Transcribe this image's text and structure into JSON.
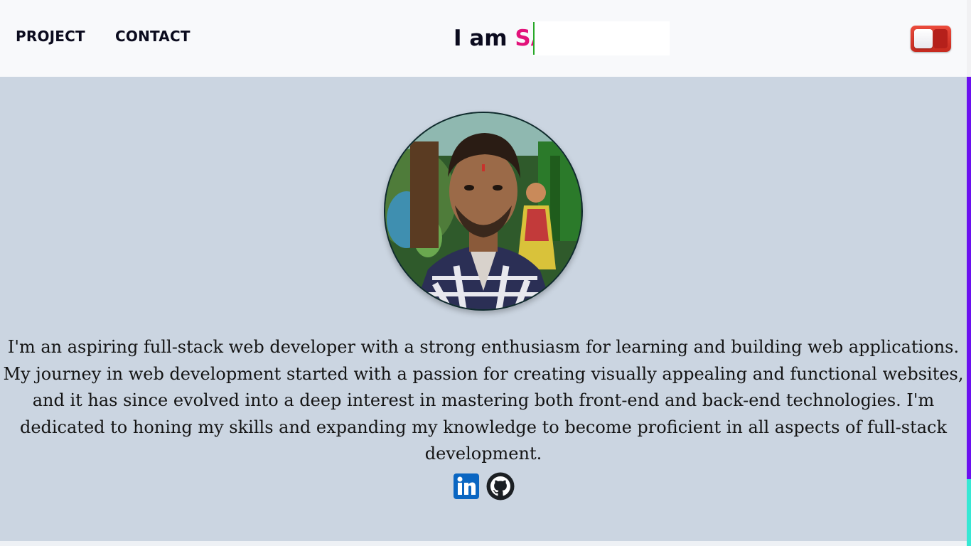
{
  "nav": {
    "links": [
      {
        "label": "PROJECT"
      },
      {
        "label": "CONTACT"
      }
    ]
  },
  "typing": {
    "prefix": "I am ",
    "typed": "SA"
  },
  "theme_toggle": {
    "state": "off"
  },
  "profile": {
    "bio": "I'm an aspiring full-stack web developer with a strong enthusiasm for learning and building web applications. My journey in web development started with a passion for creating visually appealing and functional websites, and it has since evolved into a deep interest in mastering both front-end and back-end technologies. I'm dedicated to honing my skills and expanding my knowledge to become proficient in all aspects of full-stack development."
  },
  "socials": [
    {
      "icon": "linkedin-icon",
      "color": "#0a66c2"
    },
    {
      "icon": "github-icon",
      "color": "#1b1f23"
    }
  ],
  "colors": {
    "background": "#cbd5e1",
    "header": "#f8f9fb",
    "accent_name": "#e2127a",
    "toggle": "#e03a2e",
    "scrollbar_thumb": "#6a0ff0"
  }
}
